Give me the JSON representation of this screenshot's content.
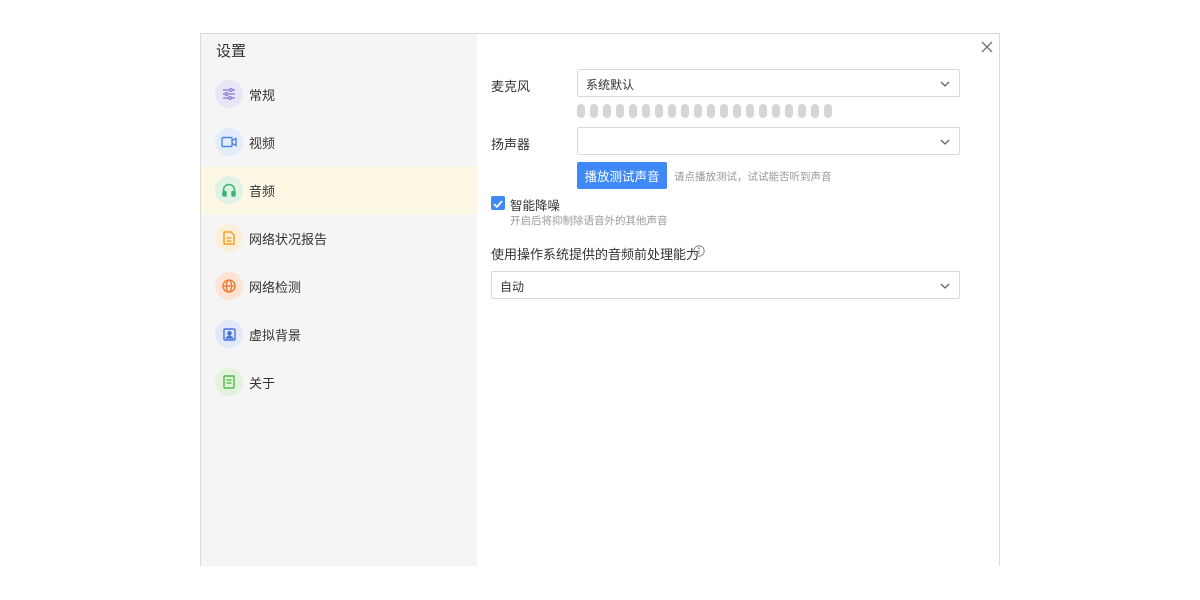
{
  "dialog": {
    "title": "设置",
    "close_icon": "close-icon"
  },
  "sidebar": {
    "active_index": 2,
    "items": [
      {
        "label": "常规",
        "icon": "sliders-icon",
        "color": "#8e83d6",
        "bg": "#e8e6f6"
      },
      {
        "label": "视频",
        "icon": "camera-icon",
        "color": "#4a88e8",
        "bg": "#e2ecfa"
      },
      {
        "label": "音频",
        "icon": "headphones-icon",
        "color": "#3cb371",
        "bg": "#dff2e6"
      },
      {
        "label": "网络状况报告",
        "icon": "report-icon",
        "color": "#f0a020",
        "bg": "#fcefd7"
      },
      {
        "label": "网络检测",
        "icon": "globe-icon",
        "color": "#f0772a",
        "bg": "#fde4d5"
      },
      {
        "label": "虚拟背景",
        "icon": "portrait-icon",
        "color": "#4a72d8",
        "bg": "#e2e8f7"
      },
      {
        "label": "关于",
        "icon": "info-doc-icon",
        "color": "#52b848",
        "bg": "#e2f2dd"
      }
    ]
  },
  "audio": {
    "mic_label": "麦克风",
    "mic_value": "系统默认",
    "mic_level": 0,
    "speaker_label": "扬声器",
    "speaker_value": "",
    "test_button": "播放测试声音",
    "test_hint": "请点播放测试，试试能否听到声音",
    "noise_label": "智能降噪",
    "noise_checked": true,
    "noise_desc": "开启后将抑制除语音外的其他声音",
    "os_label": "使用操作系统提供的音频前处理能力",
    "os_value": "自动"
  },
  "colors": {
    "accent": "#3f88f8",
    "active_nav": "#fdf8e4",
    "sidebar_bg": "#f5f5f5"
  }
}
